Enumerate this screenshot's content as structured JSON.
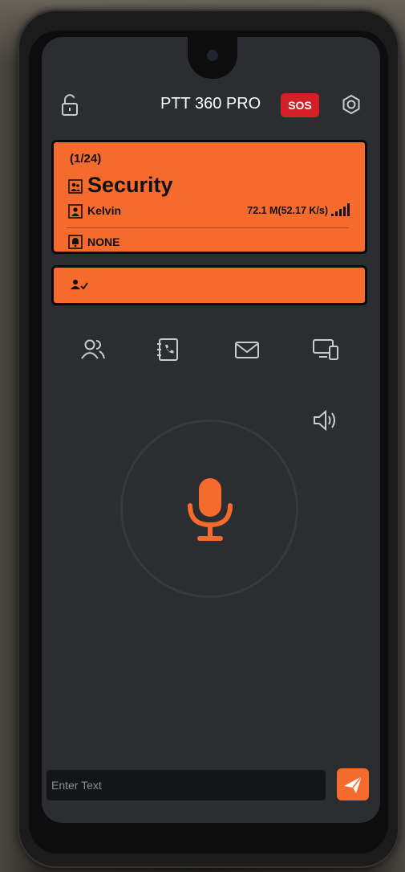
{
  "app": {
    "title": "PTT 360 PRO",
    "sos_label": "SOS"
  },
  "group": {
    "count": "(1/24)",
    "name": "Security"
  },
  "user": {
    "name": "Kelvin",
    "speed": "72.1 M(52.17 K/s)"
  },
  "alert": {
    "text": "NONE"
  },
  "message": {
    "placeholder": "Enter Text"
  },
  "icons": {
    "lock": "unlock-icon",
    "settings": "gear-icon",
    "nav": [
      "contacts-icon",
      "call-log-icon",
      "mail-icon",
      "devices-icon"
    ],
    "speaker": "speaker-icon",
    "mic": "microphone-icon",
    "send": "send-icon"
  },
  "colors": {
    "accent": "#f56a2d",
    "sos": "#d32028",
    "screen_bg": "#2b2d30"
  }
}
